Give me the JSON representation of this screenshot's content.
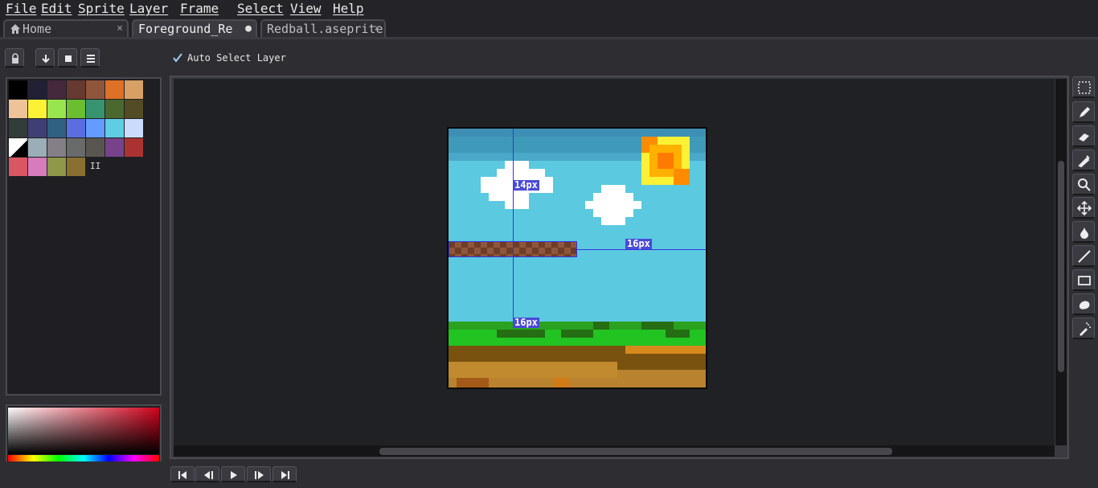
{
  "menu": {
    "items": [
      "File",
      "Edit",
      "Sprite",
      "Layer",
      "Frame",
      "Select",
      "View",
      "Help"
    ]
  },
  "tabs": [
    {
      "label": "Home",
      "icon": "home-icon",
      "close": "×"
    },
    {
      "label": "Foreground_Re",
      "icon": "",
      "close": "●"
    },
    {
      "label": "Redball.aseprite",
      "icon": "",
      "close": "×"
    }
  ],
  "toolbar": {
    "auto_select_label": "Auto Select Layer",
    "auto_select_checked": true,
    "buttons": [
      "lock-icon",
      "arrow-down-icon",
      "square-icon",
      "menu-icon"
    ]
  },
  "palette": {
    "count_label": "II",
    "colors": [
      "#000000",
      "#222034",
      "#45283c",
      "#663931",
      "#8f563b",
      "#df7126",
      "#d9a066",
      "#eec39a",
      "#fbf236",
      "#99e550",
      "#6abe30",
      "#37946e",
      "#4b692f",
      "#524b24",
      "#323c39",
      "#3f3f74",
      "#306082",
      "#5b6ee1",
      "#639bff",
      "#5fcde4",
      "#cbdbfc",
      "#ffffff",
      "#9badb7",
      "#847e87",
      "#696a6a",
      "#595652",
      "#76428a",
      "#ac3232",
      "#d95763",
      "#d77bba",
      "#8f974a",
      "#8a6f30"
    ]
  },
  "color_picker": {
    "selected_hue": "#d0021b"
  },
  "canvas": {
    "guide_labels": [
      "14px",
      "16px",
      "16px"
    ],
    "selection_color": "#3434e0"
  },
  "tools": [
    "marquee-icon",
    "pencil-icon",
    "eraser-icon",
    "eyedropper-icon",
    "zoom-icon",
    "move-icon",
    "fill-icon",
    "line-icon",
    "rectangle-icon",
    "blob-icon",
    "spray-icon"
  ],
  "timeline": {
    "buttons": [
      "first-frame-icon",
      "previous-frame-icon",
      "play-icon",
      "next-frame-icon",
      "last-frame-icon"
    ]
  }
}
